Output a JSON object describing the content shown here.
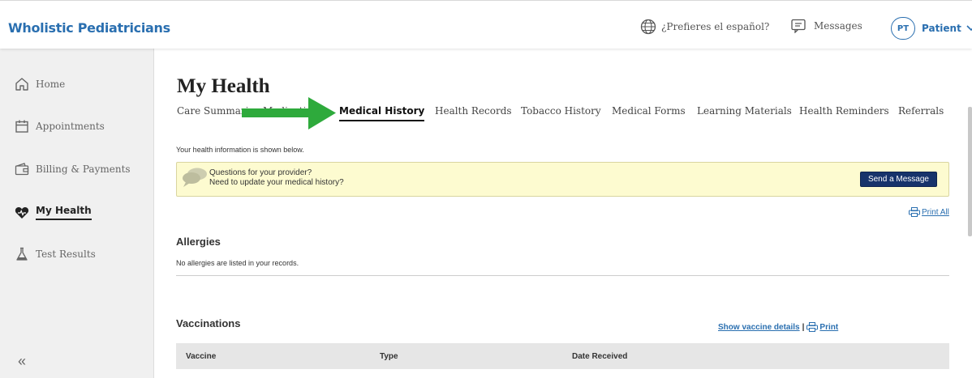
{
  "app": {
    "brand": "Wholistic Pediatricians"
  },
  "header": {
    "language_link": "¿Prefieres el español?",
    "messages": "Messages",
    "avatar_initials": "PT",
    "user_label": "Patient"
  },
  "sidebar": {
    "items": [
      {
        "label": "Home",
        "icon": "home-icon"
      },
      {
        "label": "Appointments",
        "icon": "calendar-icon"
      },
      {
        "label": "Billing & Payments",
        "icon": "wallet-icon"
      },
      {
        "label": "My Health",
        "icon": "heart-icon",
        "active": true
      },
      {
        "label": "Test Results",
        "icon": "flask-icon"
      }
    ],
    "collapse": "«"
  },
  "main": {
    "title": "My Health",
    "tabs": [
      {
        "label": "Care Summaries"
      },
      {
        "label": "Medications"
      },
      {
        "label": "Medical History",
        "active": true
      },
      {
        "label": "Health Records"
      },
      {
        "label": "Tobacco History"
      },
      {
        "label": "Medical Forms"
      },
      {
        "label": "Learning Materials"
      },
      {
        "label": "Health Reminders"
      },
      {
        "label": "Referrals"
      }
    ],
    "intro": "Your health information is shown below.",
    "banner": {
      "line1": "Questions for your provider?",
      "line2": "Need to update your medical history?",
      "button": "Send a Message"
    },
    "print_all": "Print All",
    "allergies": {
      "heading": "Allergies",
      "note": "No allergies are listed in your records."
    },
    "vaccinations": {
      "heading": "Vaccinations",
      "show_details": "Show vaccine details",
      "separator": "|",
      "print": "Print",
      "columns": [
        "Vaccine",
        "Type",
        "Date Received"
      ]
    }
  },
  "colors": {
    "brand": "#2a6fb0",
    "arrow": "#2eaa3c",
    "banner_bg": "#fdfbd0",
    "button_bg": "#17336b"
  }
}
